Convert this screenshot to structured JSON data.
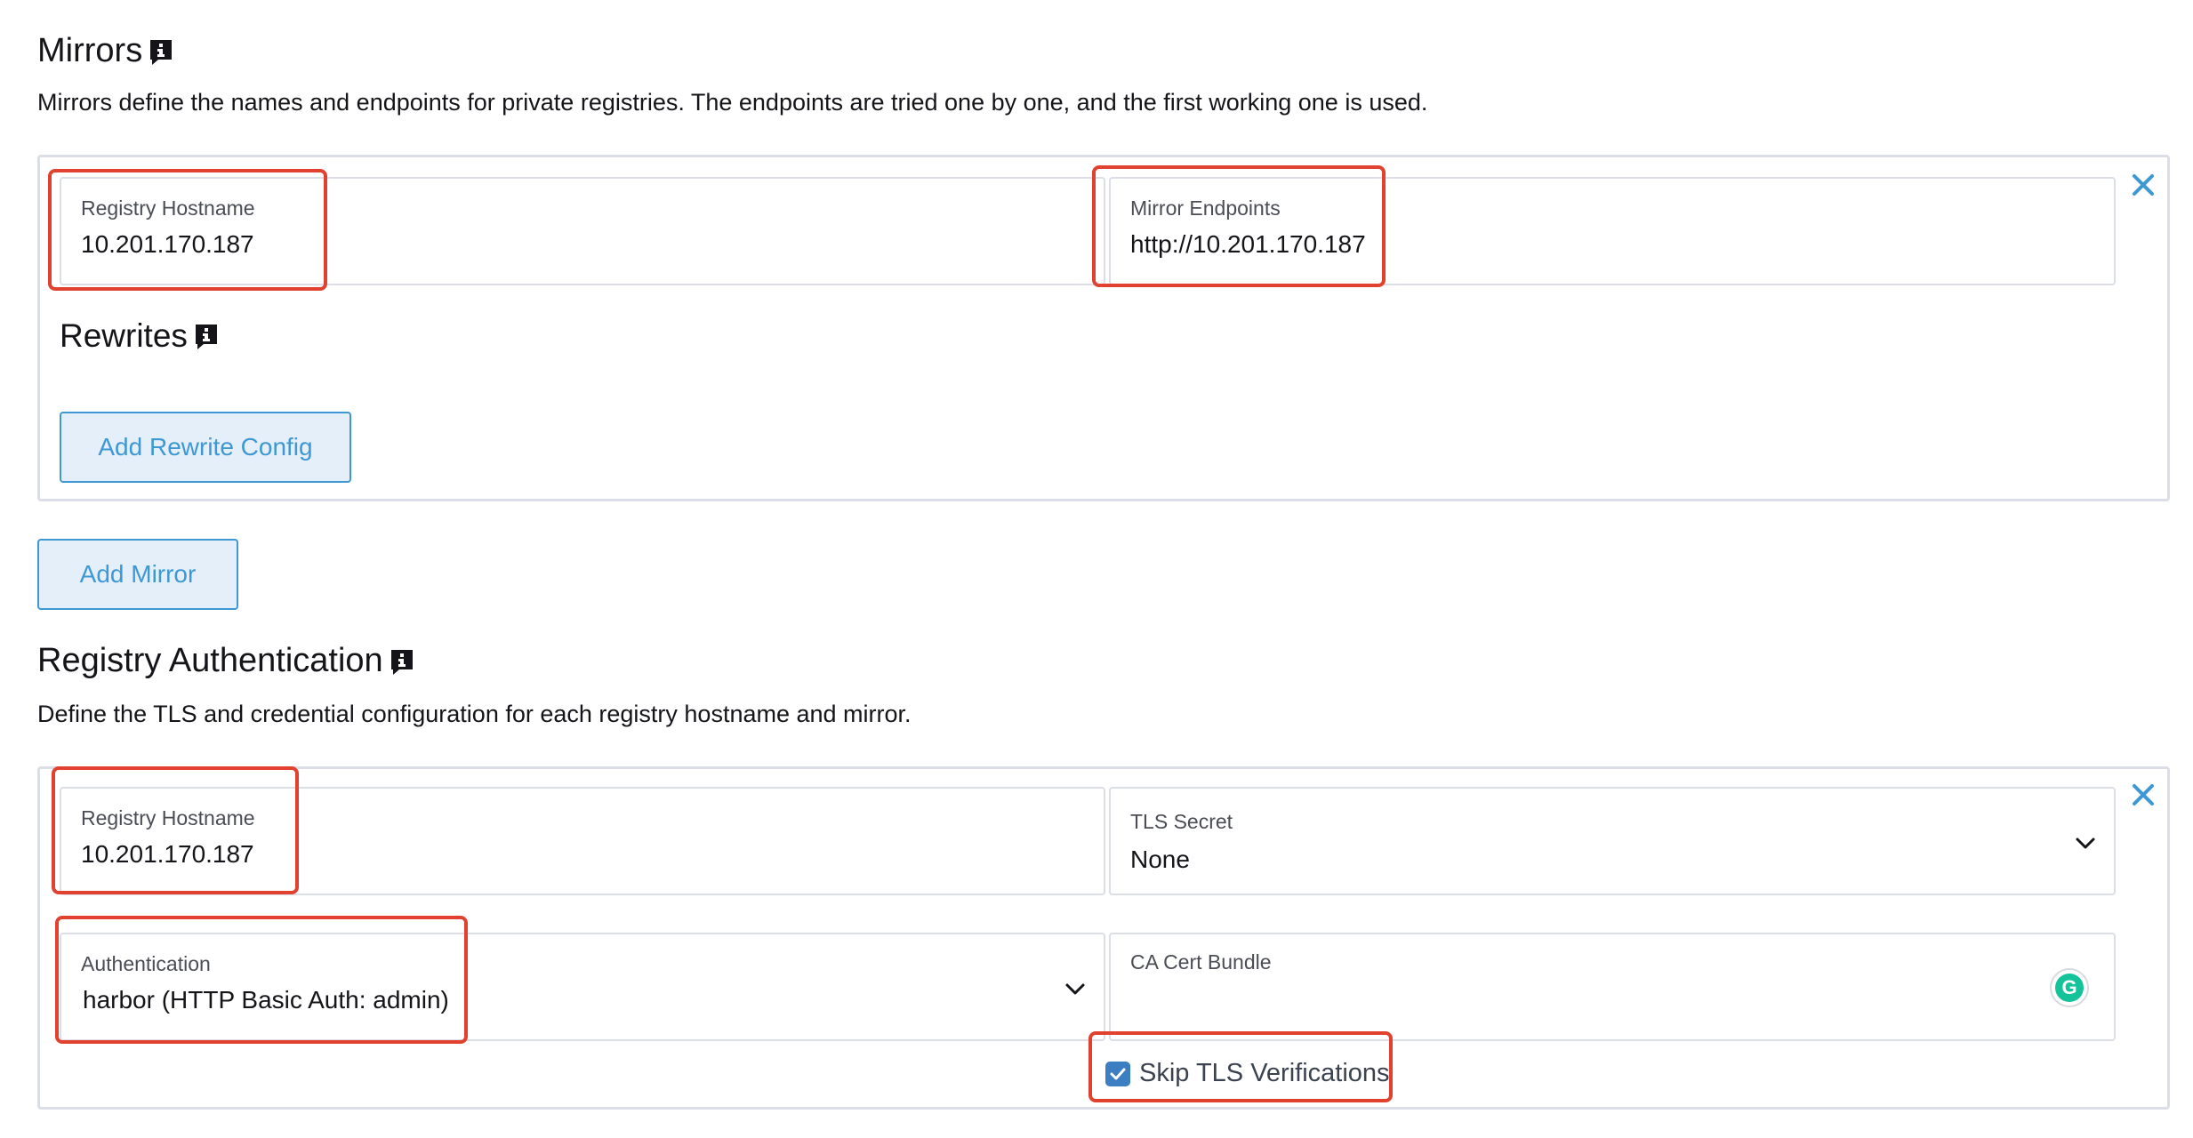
{
  "mirrors": {
    "title": "Mirrors",
    "description": "Mirrors define the names and endpoints for private registries. The endpoints are tried one by one, and the first working one is used.",
    "entry": {
      "registry_hostname_label": "Registry Hostname",
      "registry_hostname_value": "10.201.170.187",
      "mirror_endpoints_label": "Mirror Endpoints",
      "mirror_endpoints_value": "http://10.201.170.187",
      "rewrites_title": "Rewrites",
      "add_rewrite_label": "Add Rewrite Config"
    },
    "add_mirror_label": "Add Mirror"
  },
  "registry_auth": {
    "title": "Registry Authentication",
    "description": "Define the TLS and credential configuration for each registry hostname and mirror.",
    "entry": {
      "registry_hostname_label": "Registry Hostname",
      "registry_hostname_value": "10.201.170.187",
      "tls_secret_label": "TLS Secret",
      "tls_secret_value": "None",
      "authentication_label": "Authentication",
      "authentication_value": "harbor (HTTP Basic Auth: admin)",
      "ca_cert_label": "CA Cert Bundle",
      "skip_tls_label": "Skip TLS Verifications",
      "skip_tls_checked": true
    }
  },
  "colors": {
    "accent": "#3d98d3",
    "highlight": "#e0422f",
    "checkbox": "#3d7ec2",
    "grammarly": "#15c39a"
  },
  "icons": [
    "info-icon",
    "close-icon",
    "chevron-down-icon",
    "checkmark-icon",
    "grammarly-icon"
  ]
}
